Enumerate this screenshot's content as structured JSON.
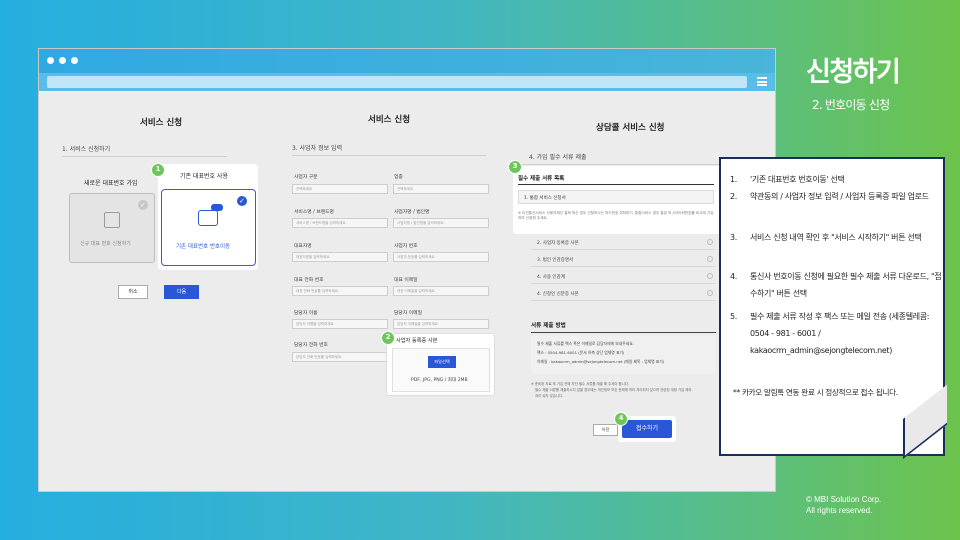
{
  "page": {
    "title": "신청하기",
    "subtitle": "2. 번호이동 신청",
    "copyright_line1": "© MBI Solution Corp.",
    "copyright_line2": "All rights reserved."
  },
  "pane1": {
    "title": "서비스 신청",
    "section": "1. 서비스 신청하기",
    "new_label": "새로운 대표번호 가입",
    "new_card_text": "신규 대표 번호 신청하기",
    "keep_label": "기존 대표번호 사용",
    "keep_card_text": "기존 대표번호 번호이동",
    "cancel": "취소",
    "next": "다음",
    "badge": "1"
  },
  "pane2": {
    "title": "서비스 신청",
    "section": "3. 사업자 정보 입력",
    "fields": [
      {
        "label": "사업자 구분",
        "placeholder": "선택하세요"
      },
      {
        "label": "업종",
        "placeholder": "선택하세요"
      },
      {
        "label": "서비스명 / 브랜드명",
        "placeholder": "서비스명 / 브랜드명을 입력하세요."
      },
      {
        "label": "사업자명 / 법인명",
        "placeholder": "사업자명 / 법인명을 입력하세요."
      },
      {
        "label": "대표자명",
        "placeholder": "대표자명을 입력하세요."
      },
      {
        "label": "사업자 번호",
        "placeholder": "사업자 번호를 입력하세요."
      },
      {
        "label": "대표 전화 번호",
        "placeholder": "대표 전화 번호를 입력하세요."
      },
      {
        "label": "대표 이메일",
        "placeholder": "대표 이메일을 입력하세요."
      },
      {
        "label": "담당자 이름",
        "placeholder": "담당자 이름을 입력하세요."
      },
      {
        "label": "담당자 이메일",
        "placeholder": "담당자 이메일을 입력하세요."
      },
      {
        "label": "담당자 전화 번호",
        "placeholder": "담당자 전화 번호를 입력하세요."
      }
    ],
    "upload_title": "사업자 등록증 사본",
    "upload_button": "파일선택",
    "upload_hint": "PDF, JPG, PNG / 최대 2MB",
    "badge": "2"
  },
  "pane3": {
    "title": "상담콜 서비스 신청",
    "section": "4. 가입 필수 서류 제출",
    "docs_header": "필수 제출 서류 목록",
    "doc_first": "1. 통합 서비스 신청서",
    "doc_note": "※ 이전통신서비스 사용자께선 결제 하신 경우 신청하시는 하드번호 취하하기, 통합서비스 경우 통장 외 4자이뢰번호를 비고에 기입하여 신청해 주세요.",
    "docs": [
      "2. 사업자 등록증 사본",
      "3. 법인 인감증명서",
      "4. 사용 인감계",
      "4. 신청인 신분증 사본"
    ],
    "method_title": "서류 제출 방법",
    "method_lines": [
      "필수 제출 서류를 팩스 혹은 이메일로 담당자에게 보내주세요.",
      "팩스 : 0504-981-6001 (문서 하측 상단 업체명 표기)",
      "이메일 : kakaocrm_admin@sejongtelecom.net (메일 제목 : 업체명 표기)"
    ],
    "notice_lines": [
      "※ 준비된 자료 후 기입 전에 자진 필수 서류를 제출 해 주셔야 합니다.",
      "필수 제출 서류를 제출하시지 않을 경우에는 개인정보 보호 문제에 따라 처리되지 않으며 관련된 계정 가입 제외",
      "처리 되지 않습니다."
    ],
    "prev": "이전",
    "submit": "접수하기",
    "badge3": "3",
    "badge4": "4"
  },
  "callout": {
    "steps": [
      {
        "num": "1.",
        "text": "'기존 대표번호 번호이동' 선택"
      },
      {
        "num": "2.",
        "text": "약관동의 / 사업자 정보 입력 / 사업자 등록증 파일 업로드"
      },
      {
        "num": "3.",
        "text": "서비스 신청 내역 확인 후 \"서비스 시작하기\" 버튼 선택"
      },
      {
        "num": "4.",
        "text": "통신사 번호이동 신청에 필요한 필수 제출 서류 다운로드, \"접수하기\" 버튼 선택"
      },
      {
        "num": "5.",
        "text": "필수 제출 서류 작성 후 팩스 또는 메일 전송 (세종텔레콤: 0504 - 981 - 6001 / kakaocrm_admin@sejongtelecom.net)"
      }
    ],
    "footnote": "** 카카오 알림톡 연동 완료 시 정상적으로 접수 됩니다."
  }
}
